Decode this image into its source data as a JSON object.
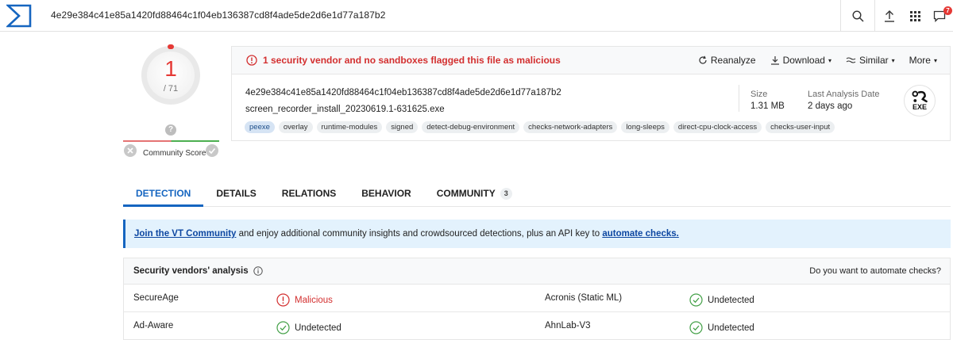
{
  "search": {
    "query": "4e29e384c41e85a1420fd88464c1f04eb136387cd8f4ade5de2d6e1d77a187b2"
  },
  "notifications": {
    "count": "7"
  },
  "score": {
    "detections": "1",
    "total": "/ 71",
    "community_label": "Community Score",
    "community_unknown": "?"
  },
  "summary": {
    "alert": "1 security vendor and no sandboxes flagged this file as malicious",
    "actions": {
      "reanalyze": "Reanalyze",
      "download": "Download",
      "similar": "Similar",
      "more": "More"
    },
    "hash": "4e29e384c41e85a1420fd88464c1f04eb136387cd8f4ade5de2d6e1d77a187b2",
    "filename": "screen_recorder_install_20230619.1-631625.exe",
    "tags": [
      "peexe",
      "overlay",
      "runtime-modules",
      "signed",
      "detect-debug-environment",
      "checks-network-adapters",
      "long-sleeps",
      "direct-cpu-clock-access",
      "checks-user-input"
    ],
    "size_label": "Size",
    "size_value": "1.31 MB",
    "last_analysis_label": "Last Analysis Date",
    "last_analysis_value": "2 days ago",
    "file_type": "EXE"
  },
  "tabs": [
    {
      "label": "DETECTION"
    },
    {
      "label": "DETAILS"
    },
    {
      "label": "RELATIONS"
    },
    {
      "label": "BEHAVIOR"
    },
    {
      "label": "COMMUNITY",
      "count": "3"
    }
  ],
  "banner": {
    "link_join": "Join the VT Community",
    "middle": " and enjoy additional community insights and crowdsourced detections, plus an API key to ",
    "link_automate": "automate checks."
  },
  "vendors": {
    "title": "Security vendors' analysis",
    "automate_prompt": "Do you want to automate checks?",
    "rows": [
      {
        "left_name": "SecureAge",
        "left_result": "Malicious",
        "right_name": "Acronis (Static ML)",
        "right_result": "Undetected"
      },
      {
        "left_name": "Ad-Aware",
        "left_result": "Undetected",
        "right_name": "AhnLab-V3",
        "right_result": "Undetected"
      }
    ]
  },
  "colors": {
    "accent": "#1565c0",
    "malicious": "#d32f2f",
    "clean": "#43a047"
  }
}
